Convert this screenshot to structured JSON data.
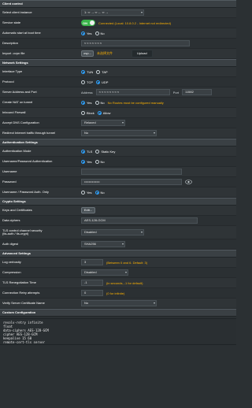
{
  "sections": {
    "client_control": "Client control",
    "network_settings": "Network Settings",
    "authentication_settings": "Authentication Settings",
    "crypto_settings": "Crypto Settings",
    "advanced_settings": "Advanced Settings",
    "custom_configuration": "Custom Configuration"
  },
  "client_control": {
    "select_instance": {
      "label": "Select client instance",
      "value": "1: ∞ → ∞ ← ∞ →"
    },
    "service_state": {
      "label": "Service state",
      "toggle": "ON",
      "status": "Connected (Local: 10.8.0.2 - Internet not redirected)"
    },
    "auto_start": {
      "label": "Automatic start at boot time",
      "yes": "Yes",
      "no": "No"
    },
    "description": {
      "label": "Description",
      "value": "≈ ≈ ≈ ≈ ≈ ≈ ≈"
    },
    "import_file": {
      "label": "Import .ovpn file",
      "file_btn": "ovp...",
      "file_note": "未选择文件",
      "upload": "Upload"
    }
  },
  "network_settings": {
    "interface_type": {
      "label": "Interface Type",
      "tun": "TUN",
      "tap": "TAP"
    },
    "protocol": {
      "label": "Protocol",
      "tcp": "TCP",
      "udp": "UDP"
    },
    "server_address": {
      "label": "Server Address and Port",
      "address_label": "Address",
      "address_value": "≈ ≈ ≈ ≈ ≈ ≈ ≈ ≈",
      "port_label": "Port",
      "port_value": "11582"
    },
    "create_nat": {
      "label": "Create NAT on tunnel",
      "yes": "Yes",
      "no": "No",
      "note": "No Routes must be configured manually"
    },
    "inbound_firewall": {
      "label": "Inbound Firewall",
      "block": "Block",
      "allow": "Allow"
    },
    "accept_dns": {
      "label": "Accept DNS Configuration",
      "value": "Relaxed"
    },
    "redirect_internet": {
      "label": "Redirect Internet traffic through tunnel",
      "value": "No"
    }
  },
  "authentication_settings": {
    "auth_mode": {
      "label": "Authentication Mode",
      "tls": "TLS",
      "static": "Static Key"
    },
    "user_pass_auth": {
      "label": "Username/Password Authentication",
      "yes": "Yes",
      "no": "No"
    },
    "username": {
      "label": "Username",
      "value": ""
    },
    "password": {
      "label": "Password",
      "value": "••••••••••••••"
    },
    "user_pass_only": {
      "label": "Username / Password Auth. Only",
      "yes": "Yes",
      "no": "No"
    }
  },
  "crypto_settings": {
    "keys_certs": {
      "label": "Keys and Certificates",
      "button": "Edit..."
    },
    "data_ciphers": {
      "label": "Data ciphers",
      "value": "AES-128-GCM"
    },
    "tls_security": {
      "label": "TLS control channel security\n(tls-auth / tls-crypt)",
      "value": "Disabled"
    },
    "auth_digest": {
      "label": "Auth digest",
      "value": "SHA256"
    }
  },
  "advanced_settings": {
    "log_verbosity": {
      "label": "Log verbosity",
      "value": "3",
      "note": "(Between 0 and 6. Default: 3)"
    },
    "compression": {
      "label": "Compression",
      "value": "Disabled"
    },
    "tls_reneg": {
      "label": "TLS Renegotiation Time",
      "value": "-1",
      "note": "(in seconds, -1 for default)"
    },
    "conn_retry": {
      "label": "Connection Retry attempts",
      "value": "0",
      "note": "(0 for infinite)"
    },
    "verify_server_cert": {
      "label": "Verify Server Certificate Name",
      "value": "No"
    }
  },
  "custom_configuration": {
    "lines": [
      "resolv-retry infinite",
      "float",
      "data-ciphers AES-128-GCM",
      "cipher AES-128-GCM",
      "keepalive 15 60",
      "remote-cert-tls server"
    ]
  },
  "colors": {
    "accent_blue": "#2ea3ff",
    "toggle_green": "#39b54a",
    "status_orange": "#ffb300"
  }
}
